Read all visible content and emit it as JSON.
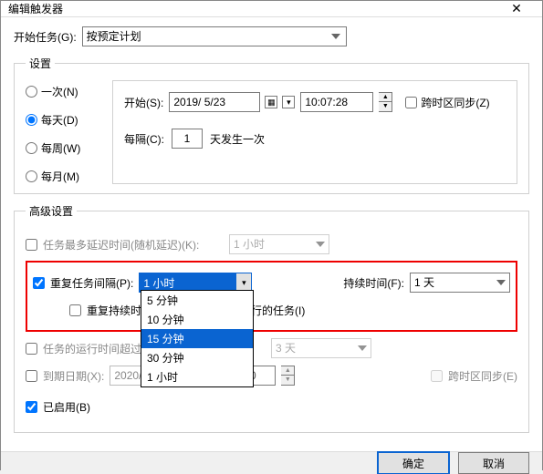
{
  "window": {
    "title": "编辑触发器"
  },
  "task": {
    "begin_label": "开始任务(G):",
    "begin_value": "按预定计划"
  },
  "settings_legend": "设置",
  "schedule_options": {
    "once": "一次(N)",
    "daily": "每天(D)",
    "weekly": "每周(W)",
    "monthly": "每月(M)"
  },
  "start": {
    "label": "开始(S):",
    "date": "2019/ 5/23",
    "time": "10:07:28",
    "cross_tz_label": "跨时区同步(Z)"
  },
  "every": {
    "label": "每隔(C):",
    "value": "1",
    "suffix": "天发生一次"
  },
  "advanced_legend": "高级设置",
  "adv": {
    "delay_label": "任务最多延迟时间(随机延迟)(K):",
    "delay_value": "1 小时",
    "repeat_label": "重复任务间隔(P):",
    "repeat_value": "1 小时",
    "duration_label": "持续时间(F):",
    "duration_value": "1 天",
    "stop_at_end_label": "重复持续时",
    "stop_at_end_suffix": "有运行的任务(I)",
    "timeout_label": "任务的运行时间超过",
    "timeout_value": "3 天",
    "expiry_label": "到期日期(X):",
    "expiry_date": "2020/",
    "expiry_time": "50",
    "cross_tz_label": "跨时区同步(E)",
    "enabled_label": "已启用(B)"
  },
  "dropdown_options": {
    "o1": "5 分钟",
    "o2": "10 分钟",
    "o3": "15 分钟",
    "o4": "30 分钟",
    "o5": "1 小时"
  },
  "buttons": {
    "ok": "确定",
    "cancel": "取消"
  }
}
